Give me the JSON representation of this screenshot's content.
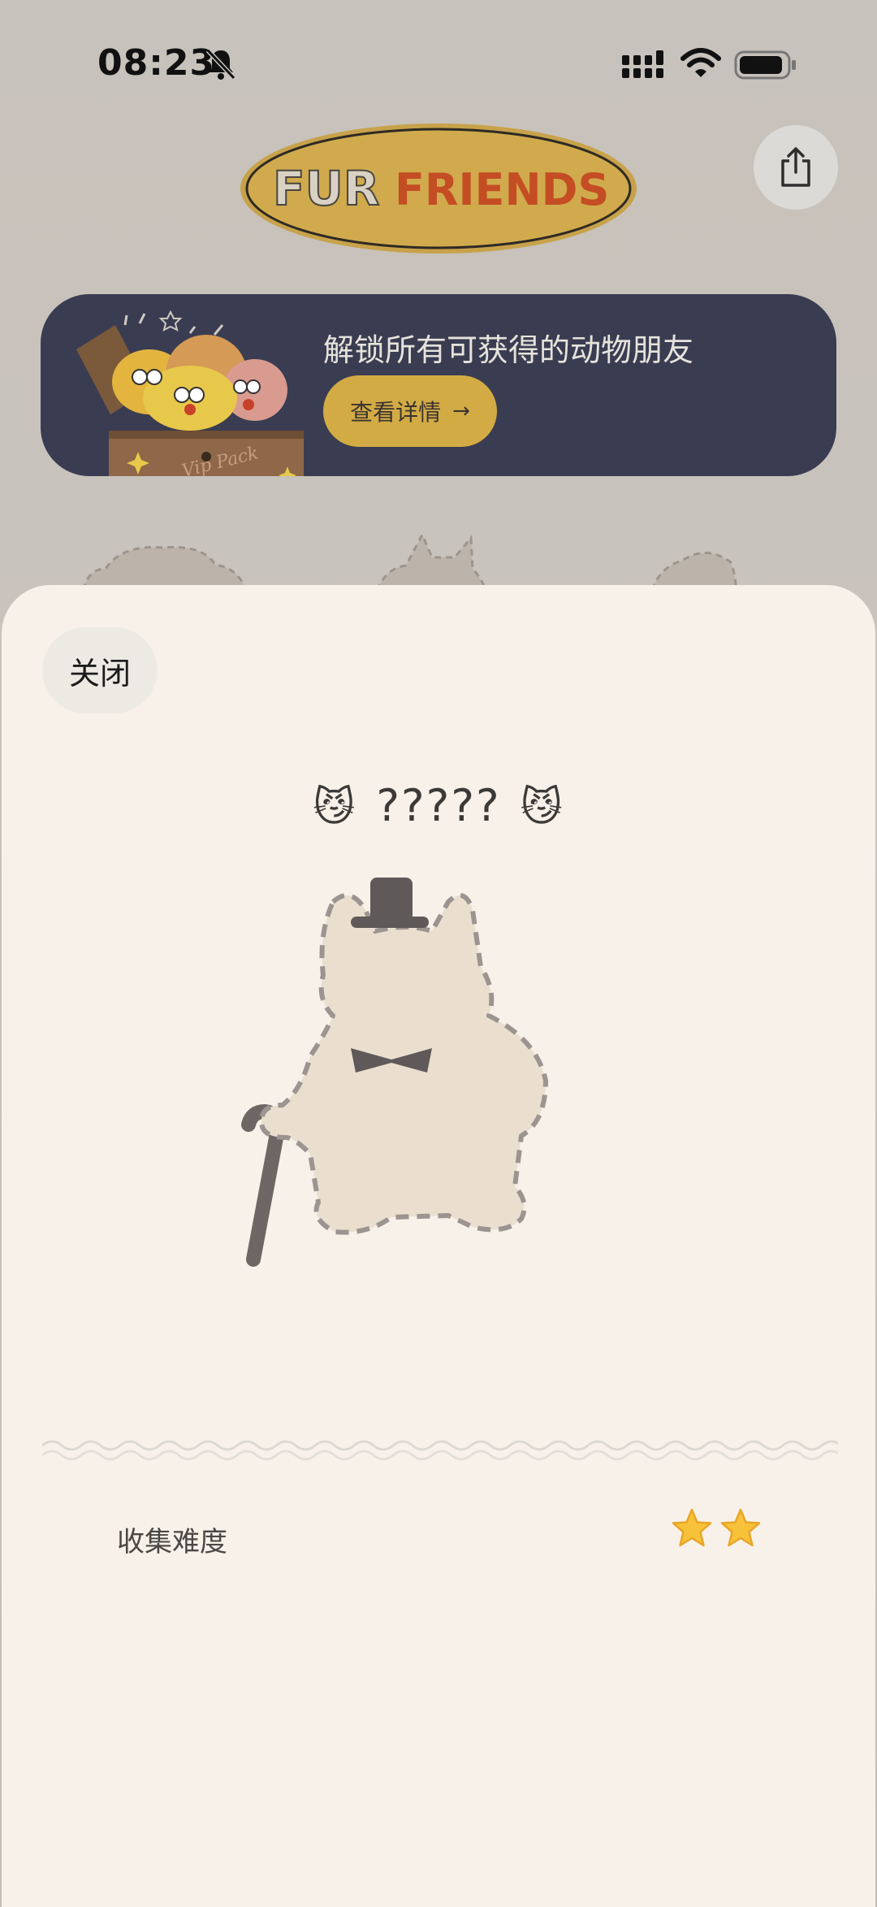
{
  "status_bar": {
    "time": "08:23",
    "icons": [
      "bell-off-icon",
      "signal-icon",
      "wifi-icon",
      "battery-icon"
    ]
  },
  "header": {
    "logo_text_part1": "FUR",
    "logo_text_part2": "FRIENDS",
    "share_icon": "share-icon"
  },
  "banner": {
    "title": "解锁所有可获得的动物朋友",
    "button_label": "查看详情",
    "button_arrow": "→",
    "chest_text": "Vip Pack"
  },
  "sheet": {
    "close_label": "关闭",
    "name_prefix_emoji": "😼",
    "animal_name": "?????",
    "name_suffix_emoji": "😼",
    "difficulty_label": "收集难度",
    "difficulty_stars": 2
  },
  "colors": {
    "banner_bg": "#3a3d51",
    "accent_gold": "#d3ab45",
    "logo_red": "#c8502a",
    "sheet_bg": "#f8f1e9",
    "star": "#f7c23a"
  }
}
